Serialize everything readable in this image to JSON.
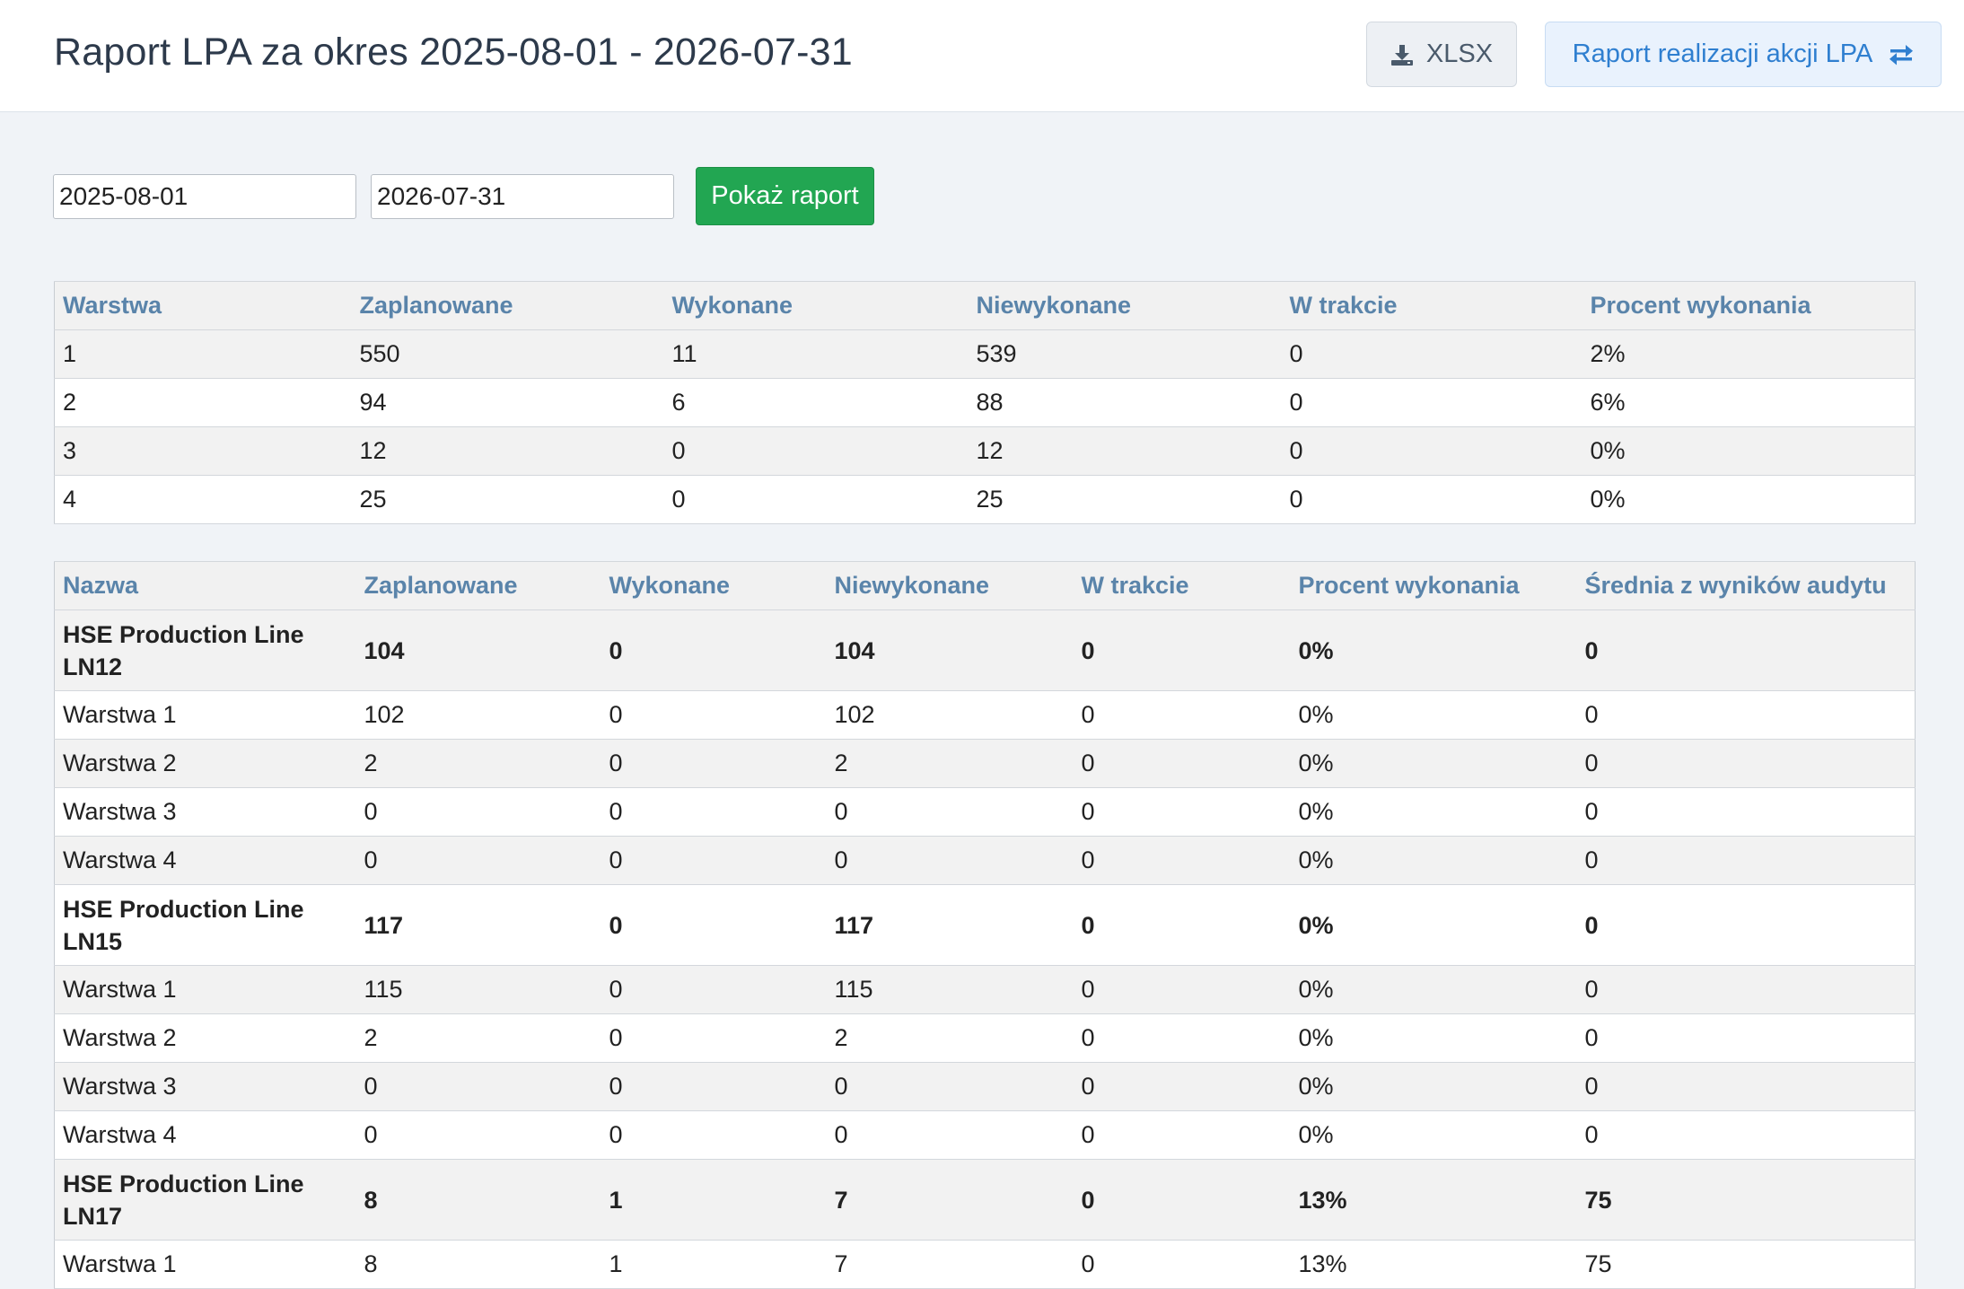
{
  "header": {
    "title": "Raport LPA za okres 2025-08-01 - 2026-07-31",
    "xlsx_label": "XLSX",
    "report_link_label": "Raport realizacji akcji LPA"
  },
  "filters": {
    "date_from": "2025-08-01",
    "date_to": "2026-07-31",
    "show_button_label": "Pokaż raport"
  },
  "summary_table": {
    "columns": [
      "Warstwa",
      "Zaplanowane",
      "Wykonane",
      "Niewykonane",
      "W trakcie",
      "Procent wykonania"
    ],
    "rows": [
      [
        "1",
        "550",
        "11",
        "539",
        "0",
        "2%"
      ],
      [
        "2",
        "94",
        "6",
        "88",
        "0",
        "6%"
      ],
      [
        "3",
        "12",
        "0",
        "12",
        "0",
        "0%"
      ],
      [
        "4",
        "25",
        "0",
        "25",
        "0",
        "0%"
      ]
    ]
  },
  "detail_table": {
    "columns": [
      "Nazwa",
      "Zaplanowane",
      "Wykonane",
      "Niewykonane",
      "W trakcie",
      "Procent wykonania",
      "Średnia z wyników audytu"
    ],
    "rows": [
      [
        "HSE Production Line LN12",
        "104",
        "0",
        "104",
        "0",
        "0%",
        "0"
      ],
      [
        "Warstwa 1",
        "102",
        "0",
        "102",
        "0",
        "0%",
        "0"
      ],
      [
        "Warstwa 2",
        "2",
        "0",
        "2",
        "0",
        "0%",
        "0"
      ],
      [
        "Warstwa 3",
        "0",
        "0",
        "0",
        "0",
        "0%",
        "0"
      ],
      [
        "Warstwa 4",
        "0",
        "0",
        "0",
        "0",
        "0%",
        "0"
      ],
      [
        "HSE Production Line LN15",
        "117",
        "0",
        "117",
        "0",
        "0%",
        "0"
      ],
      [
        "Warstwa 1",
        "115",
        "0",
        "115",
        "0",
        "0%",
        "0"
      ],
      [
        "Warstwa 2",
        "2",
        "0",
        "2",
        "0",
        "0%",
        "0"
      ],
      [
        "Warstwa 3",
        "0",
        "0",
        "0",
        "0",
        "0%",
        "0"
      ],
      [
        "Warstwa 4",
        "0",
        "0",
        "0",
        "0",
        "0%",
        "0"
      ],
      [
        "HSE Production Line LN17",
        "8",
        "1",
        "7",
        "0",
        "13%",
        "75"
      ],
      [
        "Warstwa 1",
        "8",
        "1",
        "7",
        "0",
        "13%",
        "75"
      ]
    ],
    "group_rows": [
      0,
      5,
      10
    ]
  },
  "icons": {
    "download": "download-icon",
    "swap": "swap-arrows-icon"
  }
}
